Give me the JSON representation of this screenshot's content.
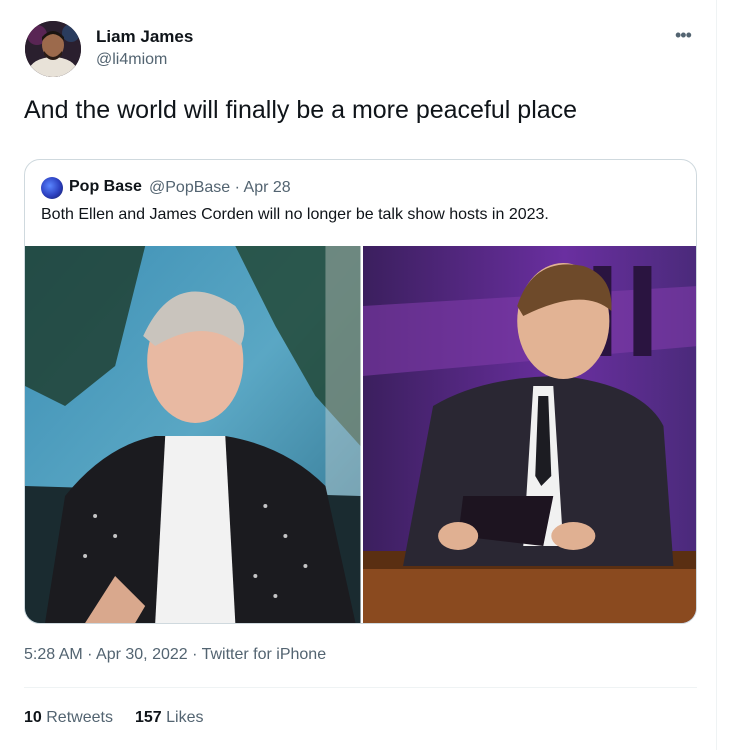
{
  "author": {
    "name": "Liam James",
    "handle": "@li4miom"
  },
  "tweet": {
    "text": "And the world will finally be a more peaceful place"
  },
  "quoted_tweet": {
    "name": "Pop Base",
    "meta": "@PopBase · Apr 28",
    "text": "Both Ellen and James Corden will no longer be talk show hosts in 2023."
  },
  "meta": {
    "timestamp": "5:28 AM · Apr 30, 2022 · Twitter for iPhone"
  },
  "stats": {
    "retweets_count": "10",
    "retweets_label": "Retweets",
    "likes_count": "157",
    "likes_label": "Likes"
  },
  "icons": {
    "more": "more-icon"
  },
  "colors": {
    "text_primary": "#0f1419",
    "text_secondary": "#536471",
    "border": "#cfd9de"
  }
}
